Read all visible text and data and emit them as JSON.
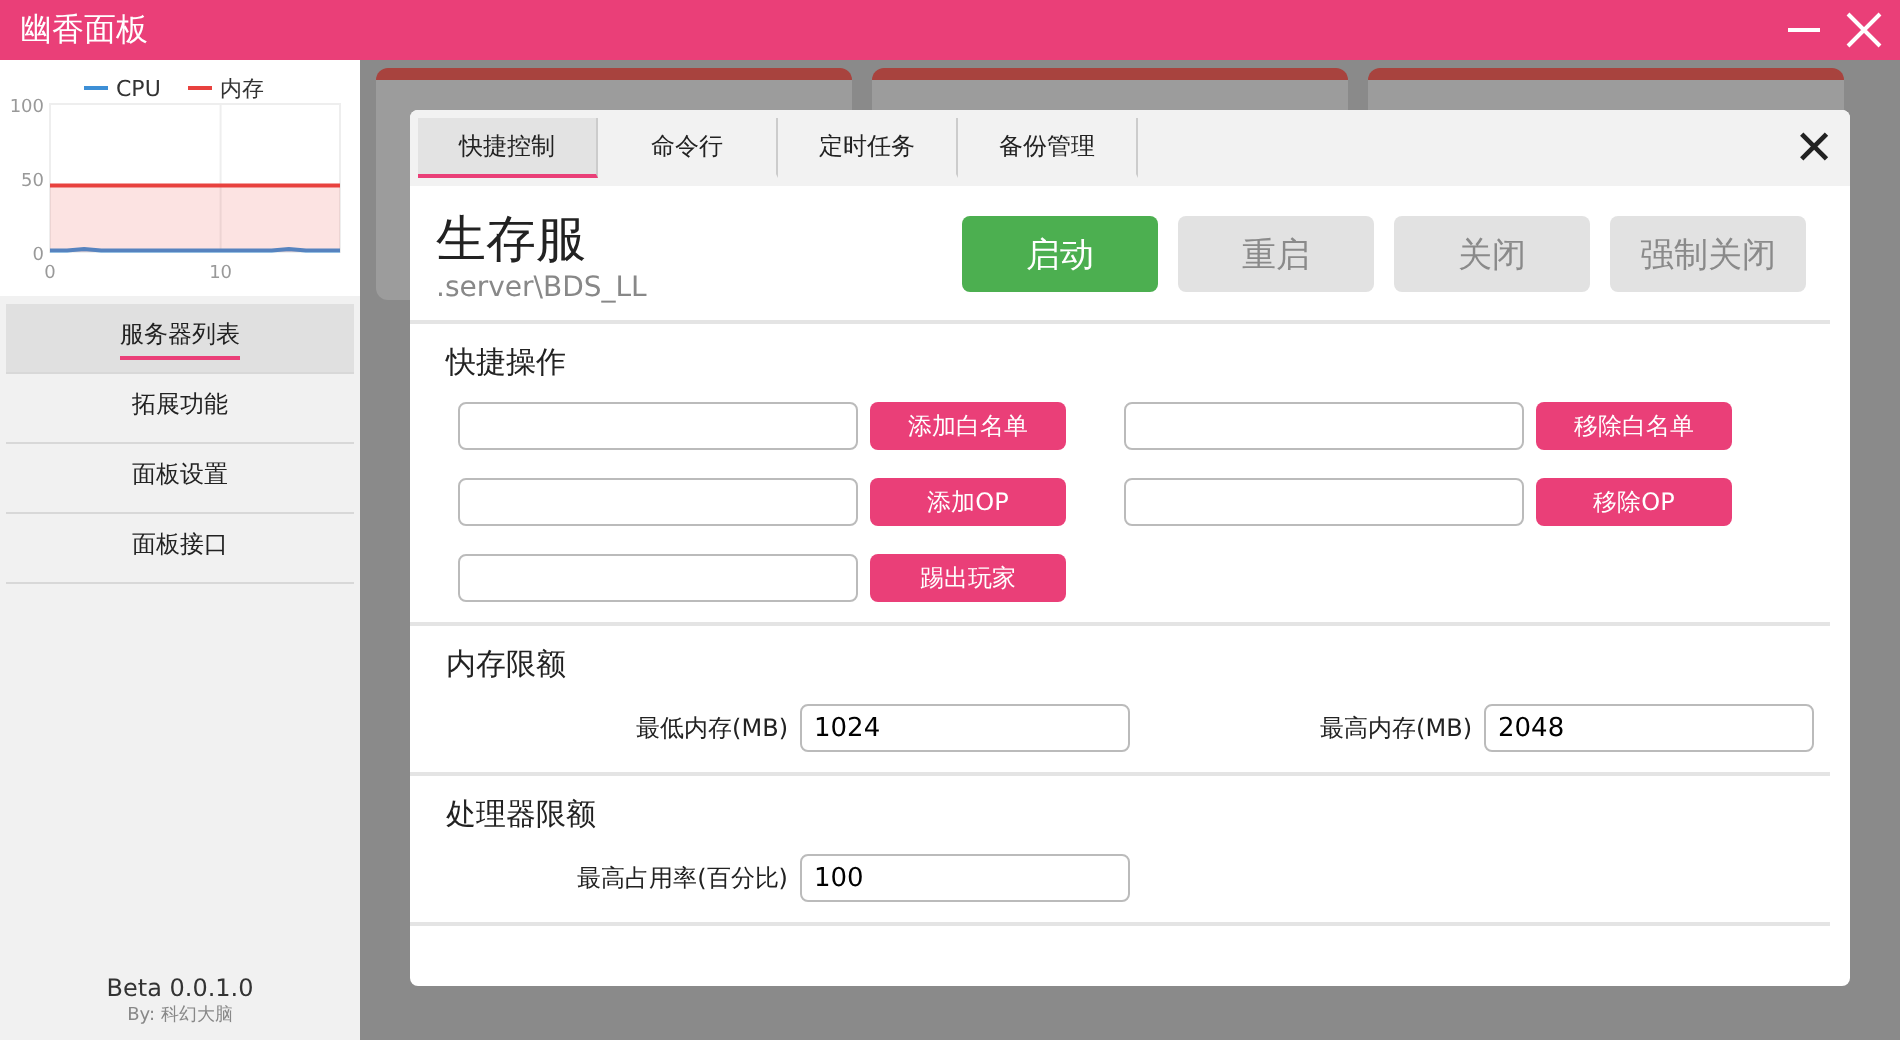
{
  "window": {
    "title": "幽香面板"
  },
  "sidebar": {
    "chart": {
      "chart_data": {
        "type": "area",
        "xticks": [
          0,
          10
        ],
        "yticks": [
          0,
          50,
          100
        ],
        "ylim": [
          0,
          100
        ],
        "legend": true,
        "xlim": [
          0,
          17
        ],
        "x": [
          0,
          1,
          2,
          3,
          4,
          5,
          6,
          7,
          8,
          9,
          10,
          11,
          12,
          13,
          14,
          15,
          16,
          17
        ],
        "series": [
          {
            "name": "CPU",
            "color": "#3d8fd6",
            "values": [
              1,
              1,
              2,
              1,
              1,
              1,
              1,
              1,
              1,
              1,
              1,
              1,
              1,
              1,
              2,
              1,
              1,
              1
            ]
          },
          {
            "name": "内存",
            "color": "#e8413e",
            "values": [
              45,
              45,
              45,
              45,
              45,
              45,
              45,
              45,
              45,
              45,
              45,
              45,
              45,
              45,
              45,
              45,
              45,
              45
            ]
          }
        ]
      }
    },
    "items": [
      {
        "label": "服务器列表",
        "selected": true
      },
      {
        "label": "拓展功能",
        "selected": false
      },
      {
        "label": "面板设置",
        "selected": false
      },
      {
        "label": "面板接口",
        "selected": false
      }
    ],
    "version": "Beta  0.0.1.0",
    "author": "By: 科幻大脑"
  },
  "server_cards": [
    {
      "kind": "card"
    },
    {
      "kind": "card"
    },
    {
      "kind": "card"
    }
  ],
  "dialog": {
    "tabs": [
      {
        "label": "快捷控制",
        "selected": true
      },
      {
        "label": "命令行",
        "selected": false
      },
      {
        "label": "定时任务",
        "selected": false
      },
      {
        "label": "备份管理",
        "selected": false
      }
    ],
    "close": "✕",
    "server_name": "生存服",
    "server_path": ".server\\BDS_LL",
    "buttons": [
      {
        "label": "启动",
        "disabled": false
      },
      {
        "label": "重启",
        "disabled": true
      },
      {
        "label": "关闭",
        "disabled": true
      },
      {
        "label": "强制关闭",
        "disabled": true
      }
    ],
    "sections": [
      {
        "title": "快捷操作",
        "kind": "actions",
        "actions": [
          {
            "button": "添加白名单"
          },
          {
            "button": "移除白名单"
          },
          {
            "button": "添加OP"
          },
          {
            "button": "移除OP"
          },
          {
            "button": "踢出玩家"
          }
        ]
      },
      {
        "title": "内存限额",
        "kind": "fields",
        "fields": [
          {
            "label": "最低内存(MB)",
            "value": "1024"
          },
          {
            "label": "最高内存(MB)",
            "value": "2048"
          }
        ]
      },
      {
        "title": "处理器限额",
        "kind": "fields",
        "fields": [
          {
            "label": "最高占用率(百分比)",
            "value": "100"
          }
        ]
      }
    ]
  }
}
